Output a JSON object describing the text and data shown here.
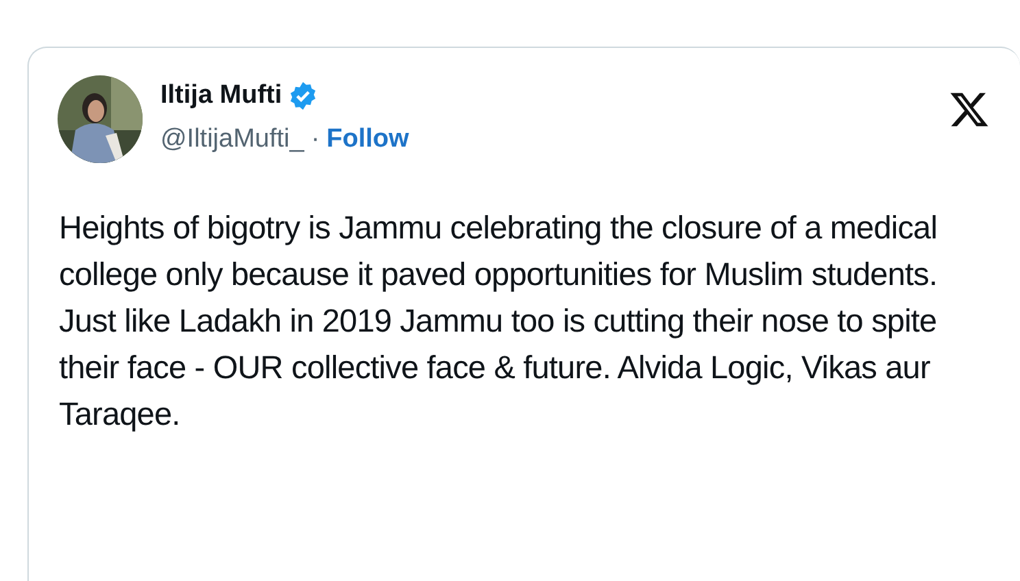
{
  "author": {
    "name": "Iltija Mufti",
    "verified": true,
    "handle": "@IltijaMufti_",
    "separator": "·",
    "follow": "Follow"
  },
  "tweet": {
    "text": "Heights of bigotry is Jammu celebrating the closure of a medical college only because it paved opportunities for Muslim students. Just like Ladakh in 2019 Jammu too is cutting their nose to spite their face - OUR collective face & future. Alvida Logic, Vikas aur Taraqee."
  }
}
